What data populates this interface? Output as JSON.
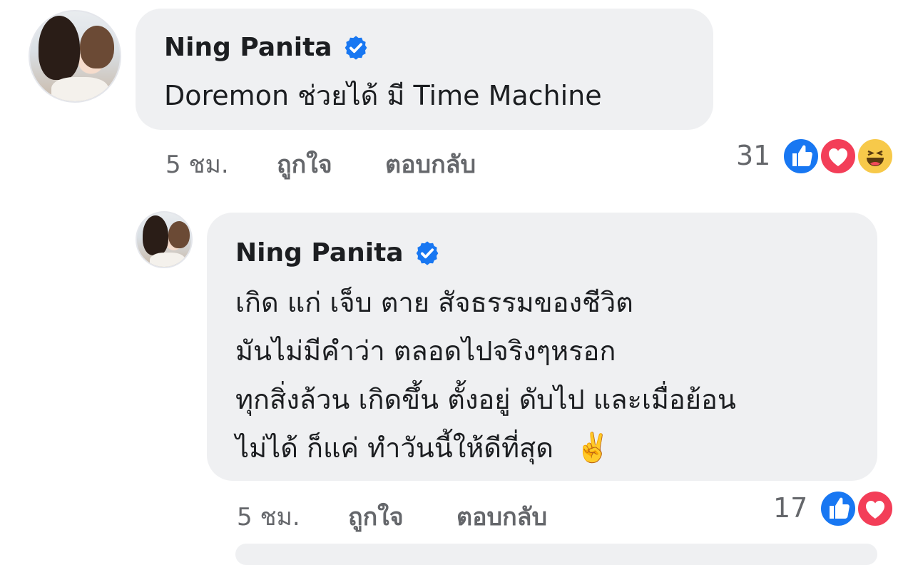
{
  "comments": [
    {
      "author": "Ning Panita",
      "verified": true,
      "text_lines": [
        "Doremon ช่วยได้ มี Time Machine"
      ],
      "time": "5 ชม.",
      "like_label": "ถูกใจ",
      "reply_label": "ตอบกลับ",
      "reaction_count": "31",
      "reactions": [
        "like-icon",
        "love-icon",
        "haha-icon"
      ]
    },
    {
      "author": "Ning Panita",
      "verified": true,
      "text_lines": [
        "เกิด แก่ เจ็บ ตาย สัจธรรมของชีวิต",
        "มันไม่มีคำว่า ตลอดไปจริงๆหรอก",
        "ทุกสิ่งล้วน เกิดขึ้น ตั้งอยู่ ดับไป และเมื่อย้อน",
        "ไม่ได้ ก็แค่ ทำวันนี้ให้ดีที่สุด"
      ],
      "emoji": "✌️",
      "time": "5 ชม.",
      "like_label": "ถูกใจ",
      "reply_label": "ตอบกลับ",
      "reaction_count": "17",
      "reactions": [
        "like-icon",
        "love-icon"
      ]
    }
  ],
  "colors": {
    "bubble": "#eff0f2",
    "like_blue": "#1877f2",
    "love_red": "#f33e58",
    "meta_gray": "#65676b"
  }
}
